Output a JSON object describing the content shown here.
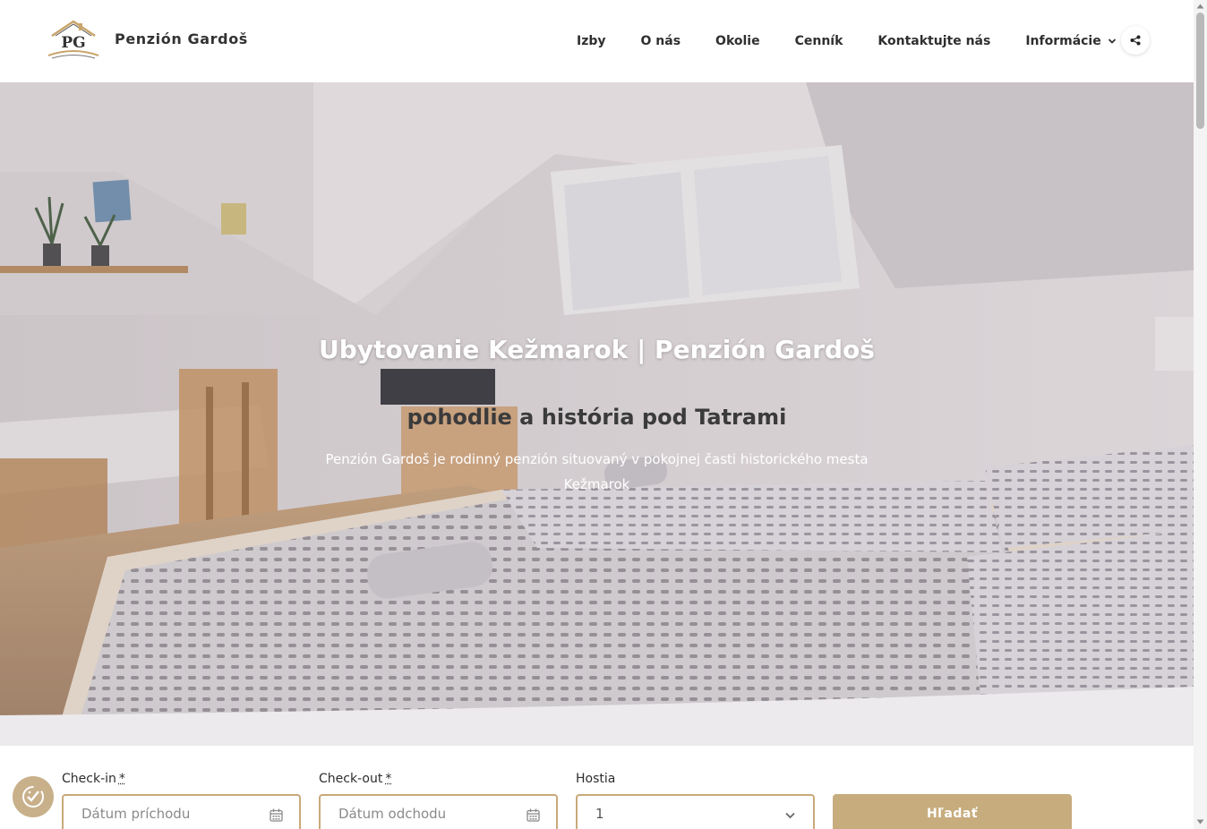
{
  "header": {
    "brand": "Penzión Gardoš",
    "logo_text": "PG",
    "nav": [
      {
        "label": "Izby"
      },
      {
        "label": "O nás"
      },
      {
        "label": "Okolie"
      },
      {
        "label": "Cenník"
      },
      {
        "label": "Kontaktujte nás"
      },
      {
        "label": "Informácie",
        "dropdown": true
      }
    ],
    "share_icon": "share-icon"
  },
  "hero": {
    "title": "Ubytovanie Kežmarok | Penzión Gardoš",
    "subtitle": "pohodlie a história pod Tatrami",
    "description": "Penzión Gardoš je rodinný penzión situovaný v pokojnej časti historického mesta Kežmarok"
  },
  "booking": {
    "checkin_label": "Check-in",
    "checkout_label": "Check-out",
    "guests_label": "Hostia",
    "required_mark": "*",
    "checkin_placeholder": "Dátum príchodu",
    "checkout_placeholder": "Dátum odchodu",
    "guests_value": "1",
    "search_label": "Hľadať",
    "calendar_icon": "calendar-icon",
    "chevron_icon": "chevron-down-icon"
  },
  "colors": {
    "accent": "#c7ac7e",
    "field_border": "#c9a97a",
    "text": "#2d2d2d"
  }
}
